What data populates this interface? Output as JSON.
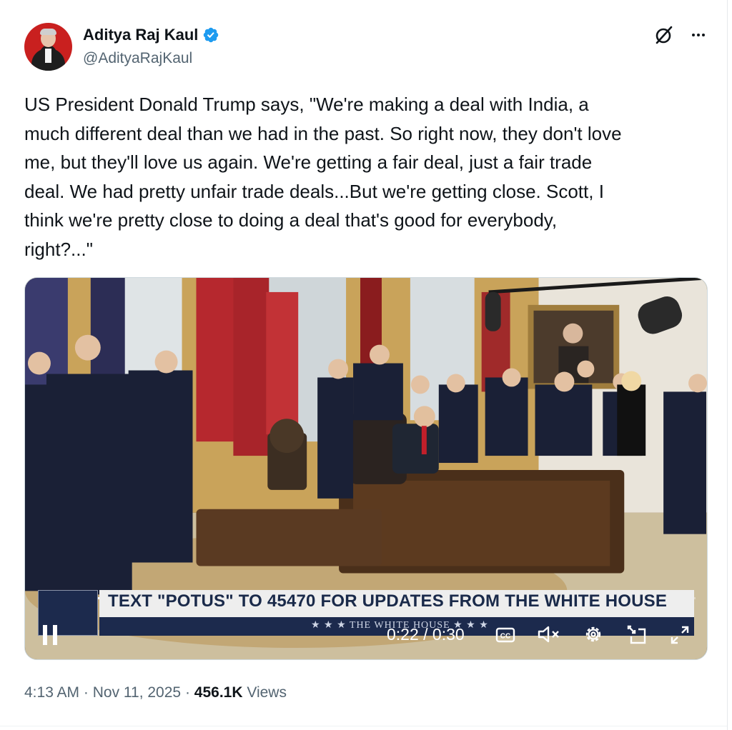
{
  "author": {
    "display_name": "Aditya Raj Kaul",
    "handle": "@AdityaRajKaul",
    "verified": true,
    "verified_color": "#1d9bf0"
  },
  "tweet": {
    "text": "US President Donald Trump says, \"We're making a deal with India, a\nmuch different deal than we had in the past. So right now, they don't love\nme, but they'll love us again. We're getting a fair deal, just a fair trade\ndeal. We had pretty unfair trade deals...But we're getting close. Scott, I\nthink we're pretty close to doing a deal that's good for everybody,\nright?...\""
  },
  "header_icons": {
    "grok": "grok-slash-circle-icon",
    "more": "more-horizontal-icon"
  },
  "video": {
    "ticker_text": "TEXT \"POTUS\" TO 45470 FOR UPDATES FROM THE WHITE HOUSE",
    "ticker_subtext": "★ ★ ★   THE WHITE HOUSE   ★ ★ ★",
    "time_display": "0:22 / 0:30",
    "progress_fraction": 0.733,
    "controls": [
      "pause-icon",
      "closed-captions-icon",
      "mute-icon",
      "settings-icon",
      "picture-in-picture-icon",
      "fullscreen-icon"
    ]
  },
  "meta": {
    "time": "4:13 AM",
    "separator": " · ",
    "date": "Nov 11, 2025",
    "views_count": "456.1K",
    "views_label": " Views"
  }
}
